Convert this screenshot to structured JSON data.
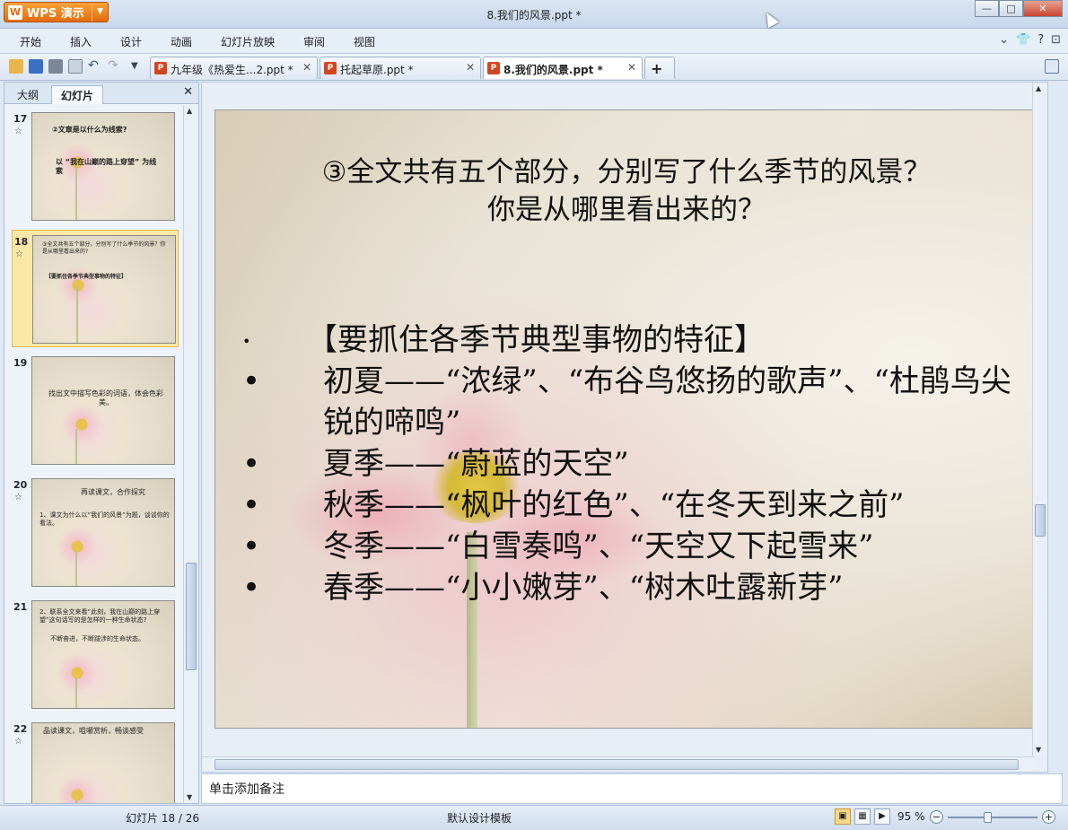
{
  "app": {
    "name": "WPS 演示",
    "logo_letter": "W",
    "document_title": "8.我们的风景.ppt *"
  },
  "menu": [
    "开始",
    "插入",
    "设计",
    "动画",
    "幻灯片放映",
    "审阅",
    "视图"
  ],
  "tabs": [
    {
      "label": "九年级《热爱生...2.ppt *"
    },
    {
      "label": "托起草原.ppt *"
    },
    {
      "label": "8.我们的风景.ppt *"
    }
  ],
  "left_panel": {
    "tab_outline": "大纲",
    "tab_slides": "幻灯片",
    "thumbs": [
      {
        "num": "17",
        "star": "☆",
        "line1": "②文章是以什么为线索?",
        "line2": "以 “我在山巅的路上穿望” 为线索"
      },
      {
        "num": "18",
        "star": "☆",
        "line1": "③全文共有五个部分，分别写了什么季节的风景？你是从哪里看出来的?",
        "line2": "【要抓住各季节典型事物的特征】"
      },
      {
        "num": "19",
        "star": "",
        "line1": "找出文中描写色彩的词语，体会色彩美。",
        "line2": ""
      },
      {
        "num": "20",
        "star": "☆",
        "line1": "再读课文，合作探究",
        "line2": "1、课文为什么以“我们的风景”为题，谈谈你的看法。"
      },
      {
        "num": "21",
        "star": "",
        "line1": "2、联系全文来看“此刻，我在山巅的路上穿望”这句话写的是怎样的一种生命状态?",
        "line2": "不断奋进，不断跋涉的生命状态。"
      },
      {
        "num": "22",
        "star": "☆",
        "line1": "品读课文，咀嚼赏析，畅谈感受",
        "line2": ""
      }
    ]
  },
  "slide": {
    "title_line1": "③全文共有五个部分，分别写了什么季节的风景？",
    "title_line2": "你是从哪里看出来的？",
    "bullets": [
      {
        "bullet": "•",
        "text": "【要抓住各季节典型事物的特征】"
      },
      {
        "bullet": "•",
        "text": "初夏——“浓绿”、“布谷鸟悠扬的歌声”、“杜鹃鸟尖锐的啼鸣”"
      },
      {
        "bullet": "•",
        "text": "夏季——“蔚蓝的天空”"
      },
      {
        "bullet": "•",
        "text": "秋季——“枫叶的红色”、“在冬天到来之前”"
      },
      {
        "bullet": "•",
        "text": "冬季——“白雪奏鸣”、“天空又下起雪来”"
      },
      {
        "bullet": "•",
        "text": "春季——“小小嫩芽”、“树木吐露新芽”"
      }
    ]
  },
  "notes_placeholder": "单击添加备注",
  "status": {
    "slide_count": "幻灯片 18 / 26",
    "template": "默认设计模板",
    "zoom": "95 %"
  },
  "colors": {
    "accent": "#e46c0a",
    "selected_thumb": "#fbe7a6"
  }
}
